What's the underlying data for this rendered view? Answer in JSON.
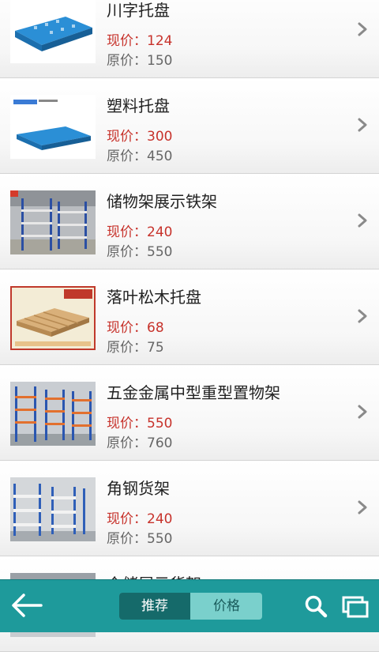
{
  "products": [
    {
      "title": "川字托盘",
      "current_label": "现价：",
      "current_price": "124",
      "original_label": "原价：",
      "original_price": "150"
    },
    {
      "title": "塑料托盘",
      "current_label": "现价：",
      "current_price": "300",
      "original_label": "原价：",
      "original_price": "450"
    },
    {
      "title": "储物架展示铁架",
      "current_label": "现价：",
      "current_price": "240",
      "original_label": "原价：",
      "original_price": "550"
    },
    {
      "title": "落叶松木托盘",
      "current_label": "现价：",
      "current_price": "68",
      "original_label": "原价：",
      "original_price": "75"
    },
    {
      "title": "五金金属中型重型置物架",
      "current_label": "现价：",
      "current_price": "550",
      "original_label": "原价：",
      "original_price": "760"
    },
    {
      "title": "角钢货架",
      "current_label": "现价：",
      "current_price": "240",
      "original_label": "原价：",
      "original_price": "550"
    },
    {
      "title": "仓储展示货架",
      "current_label": "",
      "current_price": "",
      "original_label": "",
      "original_price": ""
    }
  ],
  "bottom_bar": {
    "tabs": [
      {
        "label": "推荐",
        "active": true
      },
      {
        "label": "价格",
        "active": false
      }
    ],
    "icons": [
      "back-arrow-icon",
      "search-icon",
      "windows-icon"
    ]
  },
  "colors": {
    "price_now": "#c7322b",
    "price_old": "#666666",
    "bottom_bar": "#1e9a9b",
    "tab_active": "#156a6a",
    "tab_inactive": "#7ad0cc"
  }
}
